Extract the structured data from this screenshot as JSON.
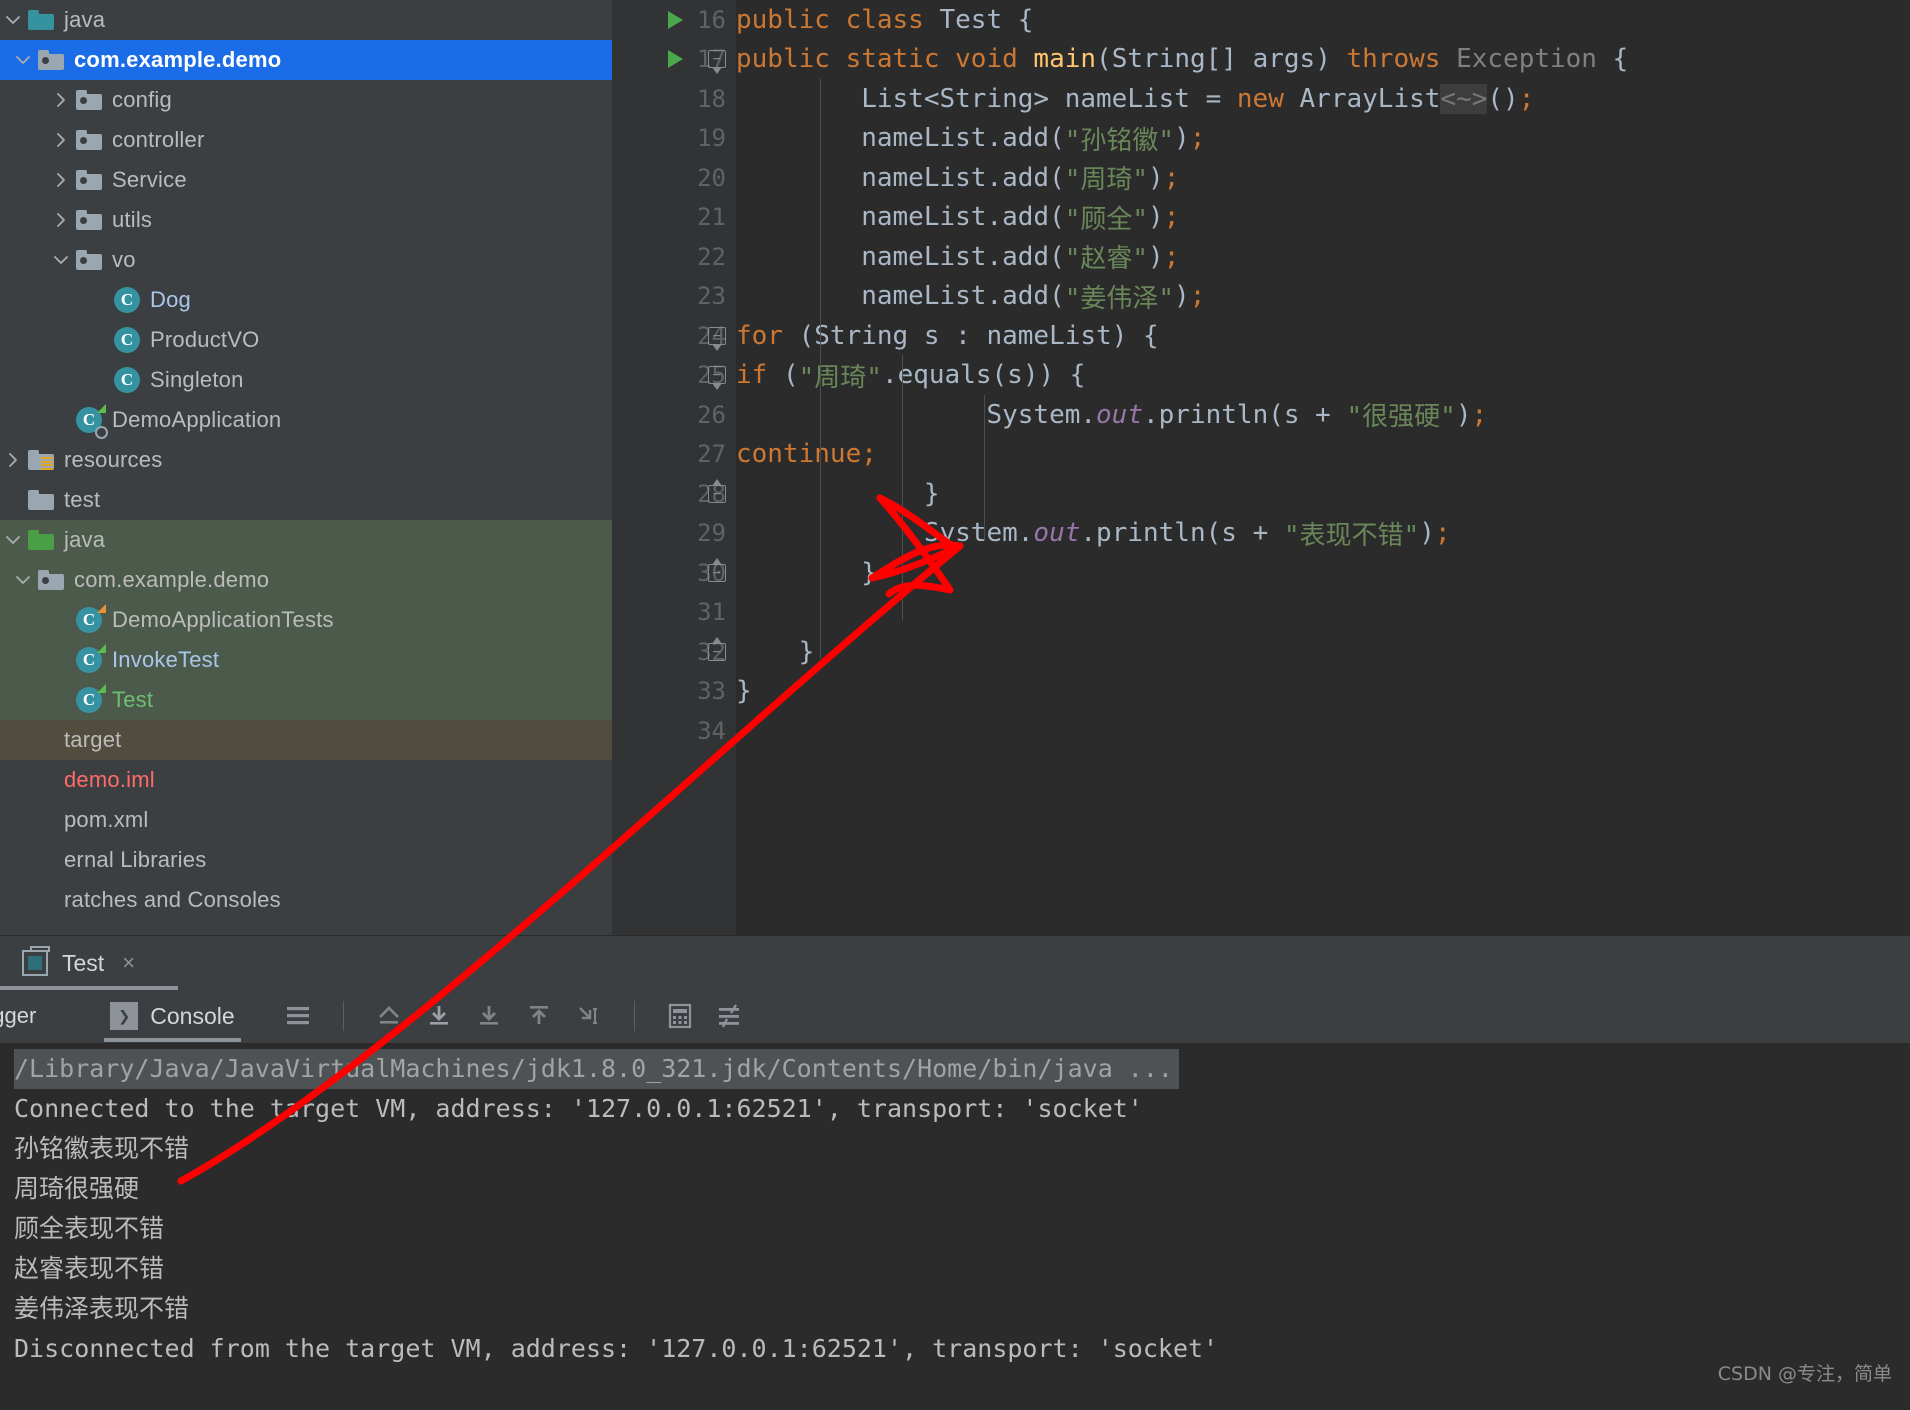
{
  "project_tree": {
    "rows": [
      {
        "indent": 0,
        "arrow": "down",
        "icon": "folder-teal",
        "label": "java",
        "color": "default",
        "state": "normal"
      },
      {
        "indent": 1,
        "arrow": "down",
        "icon": "folder-package",
        "label": "com.example.demo",
        "color": "white",
        "state": "selected"
      },
      {
        "indent": 2,
        "arrow": "right",
        "icon": "folder-package",
        "label": "config",
        "color": "default",
        "state": "normal"
      },
      {
        "indent": 2,
        "arrow": "right",
        "icon": "folder-package",
        "label": "controller",
        "color": "default",
        "state": "normal"
      },
      {
        "indent": 2,
        "arrow": "right",
        "icon": "folder-package",
        "label": "Service",
        "color": "default",
        "state": "normal"
      },
      {
        "indent": 2,
        "arrow": "right",
        "icon": "folder-package",
        "label": "utils",
        "color": "default",
        "state": "normal"
      },
      {
        "indent": 2,
        "arrow": "down",
        "icon": "folder-package",
        "label": "vo",
        "color": "default",
        "state": "normal"
      },
      {
        "indent": 3,
        "arrow": "none",
        "icon": "class",
        "label": "Dog",
        "color": "blue",
        "state": "normal"
      },
      {
        "indent": 3,
        "arrow": "none",
        "icon": "class",
        "label": "ProductVO",
        "color": "default",
        "state": "normal"
      },
      {
        "indent": 3,
        "arrow": "none",
        "icon": "class",
        "label": "Singleton",
        "color": "default",
        "state": "normal"
      },
      {
        "indent": 2,
        "arrow": "none",
        "icon": "class-spring-run",
        "label": "DemoApplication",
        "color": "default",
        "state": "normal"
      },
      {
        "indent": 0,
        "arrow": "right",
        "icon": "folder-resources",
        "label": "resources",
        "color": "default",
        "state": "normal"
      },
      {
        "indent": -1,
        "arrow": "none",
        "icon": "folder-grey",
        "label": "test",
        "color": "default",
        "state": "normal"
      },
      {
        "indent": 0,
        "arrow": "down",
        "icon": "folder-green",
        "label": "java",
        "color": "default",
        "state": "testsrc"
      },
      {
        "indent": 1,
        "arrow": "down",
        "icon": "folder-package",
        "label": "com.example.demo",
        "color": "default",
        "state": "testsrc"
      },
      {
        "indent": 2,
        "arrow": "none",
        "icon": "class-test-orange",
        "label": "DemoApplicationTests",
        "color": "default",
        "state": "testsrc"
      },
      {
        "indent": 2,
        "arrow": "none",
        "icon": "class-run",
        "label": "InvokeTest",
        "color": "blue",
        "state": "testsrc"
      },
      {
        "indent": 2,
        "arrow": "none",
        "icon": "class-run",
        "label": "Test",
        "color": "green",
        "state": "testsrc"
      },
      {
        "indent": -1,
        "arrow": "none",
        "icon": "none",
        "label": "target",
        "color": "default",
        "state": "targetdir"
      },
      {
        "indent": -1,
        "arrow": "none",
        "icon": "none",
        "label": "demo.iml",
        "color": "red",
        "state": "normal"
      },
      {
        "indent": -1,
        "arrow": "none",
        "icon": "none",
        "label": "pom.xml",
        "color": "default",
        "state": "normal"
      },
      {
        "indent": -1,
        "arrow": "none",
        "icon": "none",
        "label": "ernal Libraries",
        "color": "default",
        "state": "normal"
      },
      {
        "indent": -1,
        "arrow": "none",
        "icon": "none",
        "label": "ratches and Consoles",
        "color": "default",
        "state": "normal"
      }
    ]
  },
  "editor": {
    "lines": [
      {
        "n": "16",
        "run": true,
        "fold": "",
        "html": "<span class='kw'>public class </span><span class='typ'>Test</span> {"
      },
      {
        "n": "17",
        "run": true,
        "fold": "down",
        "html": "    <span class='kw'>public static void </span><span class='fn'>main</span>(String[] args) <span class='kw'>throws </span><span class='dim'>Exception </span>{"
      },
      {
        "n": "18",
        "run": false,
        "fold": "",
        "html": "        List&lt;String&gt; nameList = <span class='kw'>new </span>ArrayList<span class='hint'>&lt;~&gt;</span>()<span class='semi'>;</span>"
      },
      {
        "n": "19",
        "run": false,
        "fold": "",
        "html": "        nameList.add(<span class='str'>\"孙铭徽\"</span>)<span class='semi'>;</span>"
      },
      {
        "n": "20",
        "run": false,
        "fold": "",
        "html": "        nameList.add(<span class='str'>\"周琦\"</span>)<span class='semi'>;</span>"
      },
      {
        "n": "21",
        "run": false,
        "fold": "",
        "html": "        nameList.add(<span class='str'>\"顾全\"</span>)<span class='semi'>;</span>"
      },
      {
        "n": "22",
        "run": false,
        "fold": "",
        "html": "        nameList.add(<span class='str'>\"赵睿\"</span>)<span class='semi'>;</span>"
      },
      {
        "n": "23",
        "run": false,
        "fold": "",
        "html": "        nameList.add(<span class='str'>\"姜伟泽\"</span>)<span class='semi'>;</span>"
      },
      {
        "n": "24",
        "run": false,
        "fold": "down",
        "html": "        <span class='kw'>for </span>(String s : nameList) {"
      },
      {
        "n": "25",
        "run": false,
        "fold": "down",
        "html": "            <span class='kw'>if </span>(<span class='str'>\"周琦\"</span>.equals(s)) {"
      },
      {
        "n": "26",
        "run": false,
        "fold": "",
        "html": "                System.<span class='fld'>out</span>.println(s + <span class='str'>\"很强硬\"</span>)<span class='semi'>;</span>"
      },
      {
        "n": "27",
        "run": false,
        "fold": "",
        "html": "                <span class='kw'>continue</span><span class='semi'>;</span>"
      },
      {
        "n": "28",
        "run": false,
        "fold": "up",
        "html": "            }"
      },
      {
        "n": "29",
        "run": false,
        "fold": "",
        "html": "            System.<span class='fld'>out</span>.println(s + <span class='str'>\"表现不错\"</span>)<span class='semi'>;</span>"
      },
      {
        "n": "30",
        "run": false,
        "fold": "up",
        "html": "        }"
      },
      {
        "n": "31",
        "run": false,
        "fold": "",
        "html": ""
      },
      {
        "n": "32",
        "run": false,
        "fold": "up",
        "html": "    }"
      },
      {
        "n": "33",
        "run": false,
        "fold": "",
        "html": "}"
      },
      {
        "n": "34",
        "run": false,
        "fold": "",
        "html": ""
      }
    ]
  },
  "run_panel": {
    "tab_label": "Test",
    "tab_close": "×",
    "debugger_label": "ugger",
    "console_label": "Console",
    "console_glyph": "❯",
    "toolbar_icons": [
      "print-lines-icon",
      "rerun-icon",
      "scroll-down-icon",
      "step-down-icon",
      "step-up-icon",
      "soft-wrap-icon",
      "calculator-icon",
      "settings-lines-icon"
    ],
    "output": [
      {
        "text": "/Library/Java/JavaVirtualMachines/jdk1.8.0_321.jdk/Contents/Home/bin/java ...",
        "style": "cmd"
      },
      {
        "text": "Connected to the target VM, address: '127.0.0.1:62521', transport: 'socket'",
        "style": "mono"
      },
      {
        "text": "孙铭徽表现不错",
        "style": "cn"
      },
      {
        "text": "周琦很强硬",
        "style": "cn"
      },
      {
        "text": "顾全表现不错",
        "style": "cn"
      },
      {
        "text": "赵睿表现不错",
        "style": "cn"
      },
      {
        "text": "姜伟泽表现不错",
        "style": "cn"
      },
      {
        "text": "Disconnected from the target VM, address: '127.0.0.1:62521', transport: 'socket'",
        "style": "mono"
      }
    ]
  },
  "annotation": {
    "type": "red-arrow",
    "color": "#ff0000",
    "points_to": "continue;"
  },
  "watermark": "CSDN @专注，简单"
}
